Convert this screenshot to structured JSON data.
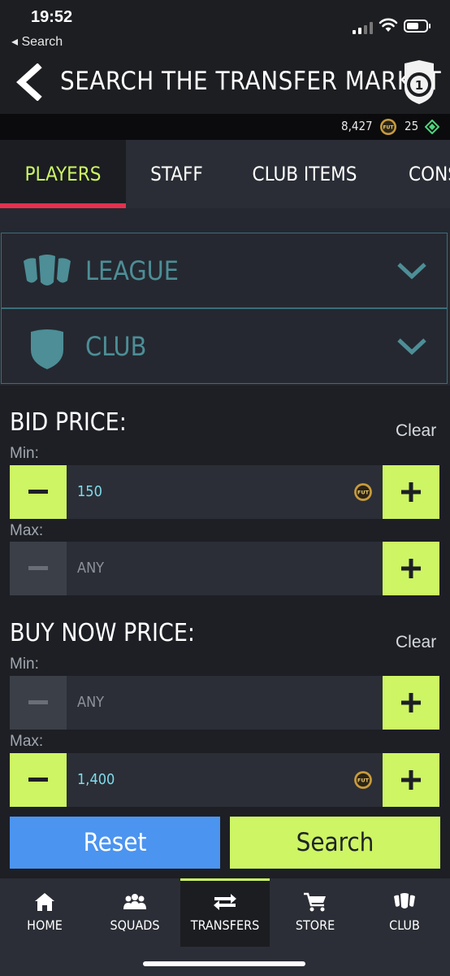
{
  "status_bar": {
    "time": "19:52",
    "back_app": "◂ Search"
  },
  "header": {
    "title": "Search the Transfer Market",
    "badge_number": "1"
  },
  "currency": {
    "coins": "8,427",
    "coin_symbol": "FUT",
    "points": "25"
  },
  "tabs": [
    "PLAYERS",
    "STAFF",
    "CLUB ITEMS",
    "CONS"
  ],
  "filters": {
    "league": "League",
    "club": "Club"
  },
  "bid_price": {
    "title": "Bid Price:",
    "clear": "Clear",
    "min_label": "Min:",
    "min_value": "150",
    "max_label": "Max:",
    "max_value": "ANY"
  },
  "buy_now_price": {
    "title": "Buy Now Price:",
    "clear": "Clear",
    "min_label": "Min:",
    "min_value": "ANY",
    "max_label": "Max:",
    "max_value": "1,400"
  },
  "actions": {
    "reset": "Reset",
    "search": "Search"
  },
  "nav": {
    "home": "HOME",
    "squads": "SQUADS",
    "transfers": "TRANSFERS",
    "store": "STORE",
    "club": "CLUB"
  },
  "colors": {
    "accent": "#cdf564",
    "tab_indicator": "#e4314e",
    "reset_button": "#4b94ef",
    "filter_text": "#4d8e97",
    "price_value": "#7fdcea"
  }
}
